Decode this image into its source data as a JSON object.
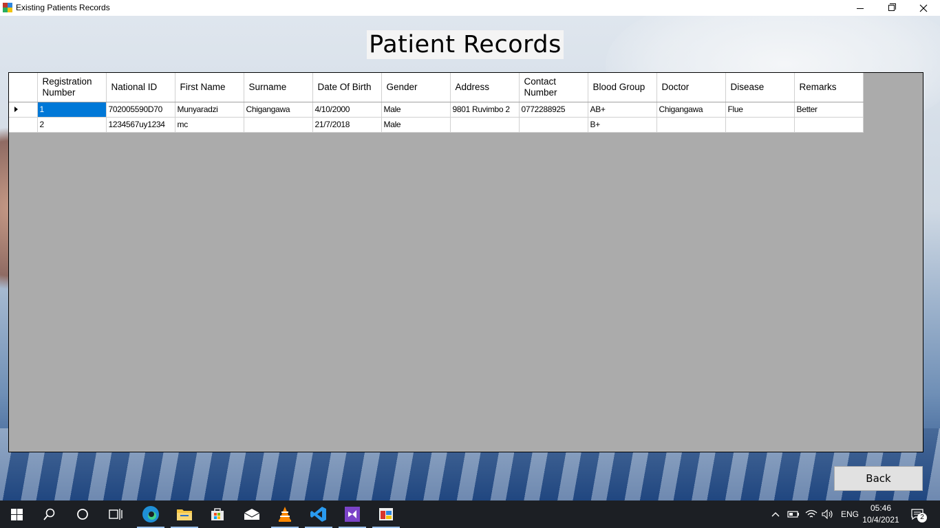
{
  "window": {
    "title": "Existing Patients Records"
  },
  "heading": "Patient Records",
  "grid": {
    "columns": [
      "Registration Number",
      "National ID",
      "First Name",
      "Surname",
      "Date Of Birth",
      "Gender",
      "Address",
      "Contact Number",
      "Blood Group",
      "Doctor",
      "Disease",
      "Remarks"
    ],
    "rows": [
      [
        "1",
        "702005590D70",
        "Munyaradzi",
        "Chigangawa",
        "4/10/2000",
        "Male",
        "9801 Ruvimbo 2",
        "0772288925",
        "AB+",
        "Chigangawa",
        "Flue",
        "Better"
      ],
      [
        "2",
        "1234567uy1234",
        "mc",
        "",
        "21/7/2018",
        "Male",
        "",
        "",
        "B+",
        "",
        "",
        ""
      ]
    ],
    "selected_cell": "1"
  },
  "back_button": "Back",
  "taskbar": {
    "language": "ENG",
    "time": "05:46",
    "date": "10/4/2021",
    "notifications": "2"
  },
  "colors": {
    "selection": "#0078d7",
    "grid_background": "#ababab",
    "taskbar": "#1c1f24"
  }
}
